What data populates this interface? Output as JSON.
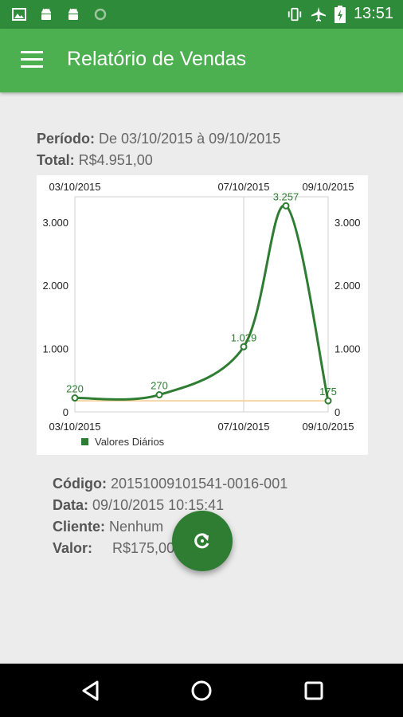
{
  "status_bar": {
    "time": "13:51",
    "left_icons": [
      "image-icon",
      "android-icon",
      "android-icon",
      "sync-icon"
    ],
    "right_icons": [
      "vibrate-icon",
      "airplane-icon",
      "battery-charging-icon"
    ]
  },
  "app_bar": {
    "title": "Relatório de Vendas"
  },
  "summary": {
    "period_label": "Período:",
    "period_value": "De 03/10/2015 à 09/10/2015",
    "total_label": "Total:",
    "total_value": "R$4.951,00"
  },
  "chart_data": {
    "type": "line",
    "x": [
      "03/10/2015",
      "05/10/2015",
      "07/10/2015",
      "08/10/2015",
      "09/10/2015"
    ],
    "series": [
      {
        "name": "Valores Diários",
        "values": [
          220,
          270,
          1029,
          3257,
          175
        ],
        "labels": [
          "220",
          "270",
          "1.029",
          "3.257",
          "175"
        ],
        "color": "#2e7d32"
      }
    ],
    "x_tick_labels": [
      "03/10/2015",
      "07/10/2015",
      "09/10/2015"
    ],
    "y_ticks": [
      0,
      1000,
      2000,
      3000
    ],
    "y_tick_labels": [
      "0",
      "1.000",
      "2.000",
      "3.000"
    ],
    "ylim": [
      0,
      3400
    ],
    "limit_line_color": "#f4c78a",
    "legend_position": "bottom-left"
  },
  "details": {
    "codigo_label": "Código:",
    "codigo_value": "20151009101541-0016-001",
    "data_label": "Data:",
    "data_value": "09/10/2015 10:15:41",
    "cliente_label": "Cliente:",
    "cliente_value": "Nenhum",
    "valor_label": "Valor:",
    "valor_value": "R$175,00"
  },
  "fab": {
    "icon": "refresh-icon"
  },
  "nav_bar": {
    "icons": [
      "back-icon",
      "home-icon",
      "recents-icon"
    ]
  }
}
